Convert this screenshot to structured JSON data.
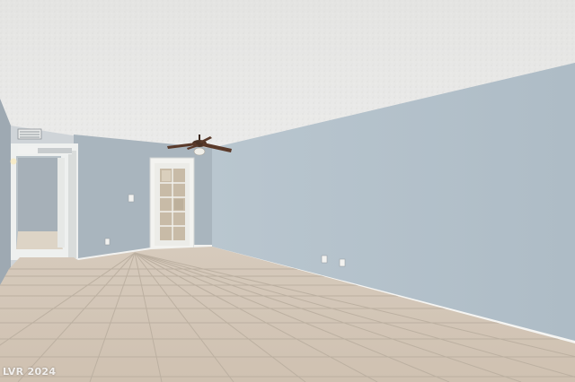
{
  "watermark": {
    "text": "LVR 2024"
  },
  "colors": {
    "ceiling": "#e6e6e4",
    "right_wall": "#b7c4cd",
    "back_wall": "#aab6bf",
    "floor": "#d2c5b6",
    "grout": "#bfb3a5",
    "baseboard": "#f4f4f2",
    "door": "#f1f1ee",
    "fan_blade": "#5a3a2a"
  },
  "icons": [
    "ceiling-fan-icon",
    "door-icon",
    "air-vent-icon",
    "wall-outlet-icon",
    "light-switch-icon"
  ]
}
